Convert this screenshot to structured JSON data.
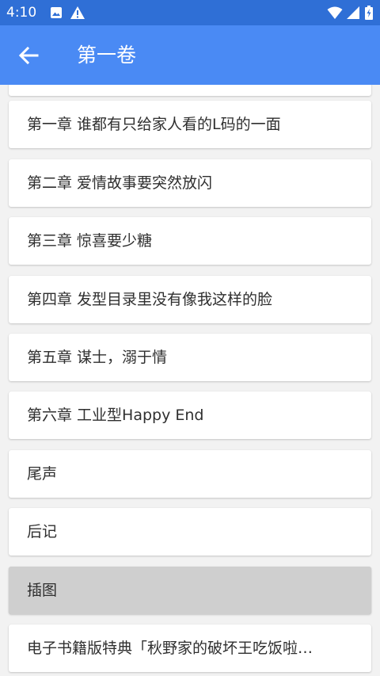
{
  "status_bar": {
    "time": "4:10"
  },
  "app_bar": {
    "title": "第一卷"
  },
  "chapters": [
    "第一章 谁都有只给家人看的L码的一面",
    "第二章 爱情故事要突然放闪",
    "第三章 惊喜要少糖",
    "第四章 发型目录里没有像我这样的脸",
    "第五章 谋士，溺于情",
    "第六章 工业型Happy End",
    "尾声",
    "后记",
    "插图",
    "电子书籍版特典「秋野家的破坏王吃饭啦…"
  ],
  "highlighted_index": 8,
  "colors": {
    "status_bar": "#2f6fd6",
    "app_bar": "#4a8af4",
    "background": "#f2f2f2",
    "card": "#ffffff",
    "card_highlight": "#cfcfcf"
  }
}
